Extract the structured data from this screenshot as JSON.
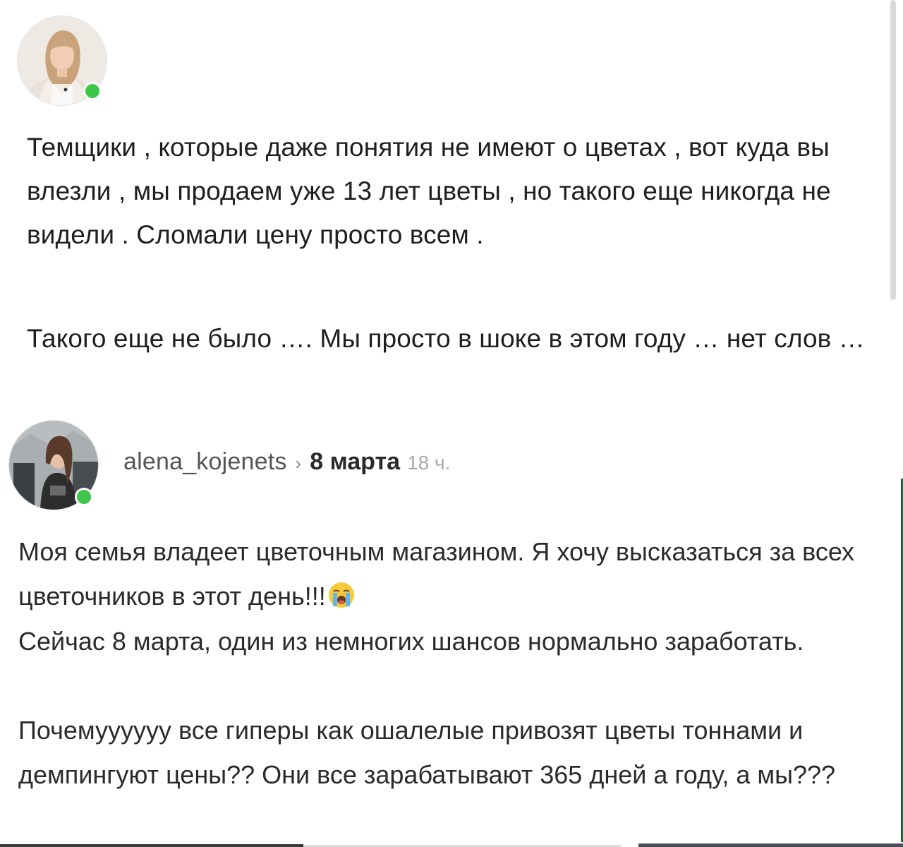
{
  "post1": {
    "paragraph1": "Темщики , которые даже понятия не имеют о цветах , вот куда вы влезли , мы продаем уже 13 лет цветы , но такого еще никогда не видели . Сломали цену просто всем .",
    "paragraph2": "Такого еще не было …. Мы просто в шоке в этом году … нет слов …",
    "online": true
  },
  "post2": {
    "username": "alena_kojenets",
    "separator": "›",
    "date": "8 марта",
    "time_ago": "18 ч.",
    "paragraph1_a": "Моя семья владеет цветочным магазином. Я хочу высказаться за всех цветочников в этот день!!!",
    "emoji": "loudly-crying-face",
    "paragraph2": "Сейчас 8 марта, один из немногих шансов нормально заработать.",
    "paragraph3": "Почемуууууу все гиперы как ошалелые привозят цветы тоннами и демпингуют цены?? Они все зарабатывают 365 дней а году, а мы???",
    "online": true
  },
  "colors": {
    "online_dot": "#3ec64a",
    "text_primary": "#1f1f1f",
    "username": "#555555",
    "time_ago": "#a8a8a8"
  }
}
